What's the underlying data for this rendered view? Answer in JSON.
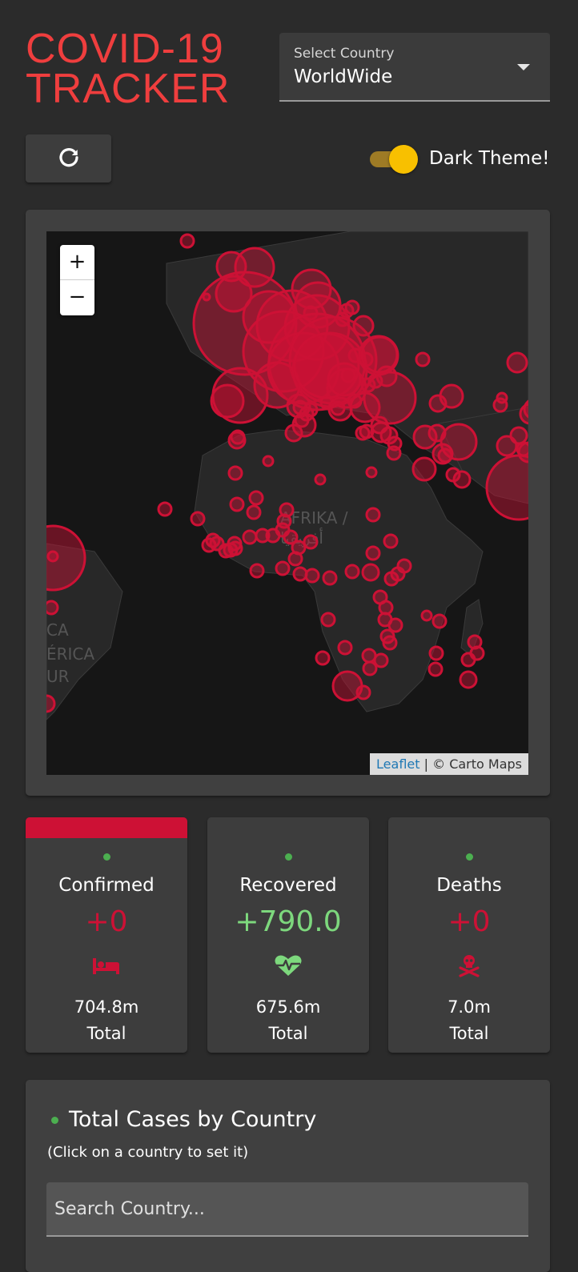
{
  "header": {
    "title_line1": "COVID-19",
    "title_line2": "TRACKER"
  },
  "country_select": {
    "label": "Select Country",
    "value": "WorldWide"
  },
  "theme_toggle": {
    "label": "Dark Theme!",
    "checked": true
  },
  "map": {
    "zoom_in": "+",
    "zoom_out": "−",
    "attribution_link": "Leaflet",
    "attribution_text": "| © Carto Maps",
    "region_label_1": "AFRIKA /",
    "region_label_2": "أفريقيا",
    "edge_label_1": "CA",
    "edge_label_2": "ÉRICA",
    "edge_label_3": "UR",
    "circle_color": "#cd1135"
  },
  "stats": {
    "confirmed": {
      "title": "Confirmed",
      "value": "+0",
      "total": "704.8m",
      "total_label": "Total",
      "color": "#cd1135",
      "icon": "bed-icon"
    },
    "recovered": {
      "title": "Recovered",
      "value": "+790.0",
      "total": "675.6m",
      "total_label": "Total",
      "color": "#7dd87d",
      "icon": "heartbeat-icon"
    },
    "deaths": {
      "title": "Deaths",
      "value": "+0",
      "total": "7.0m",
      "total_label": "Total",
      "color": "#cd1135",
      "icon": "skull-crossbones-icon"
    }
  },
  "table": {
    "title": "Total Cases by Country",
    "hint": "(Click on a country to set it)",
    "search_placeholder": "Search Country..."
  }
}
